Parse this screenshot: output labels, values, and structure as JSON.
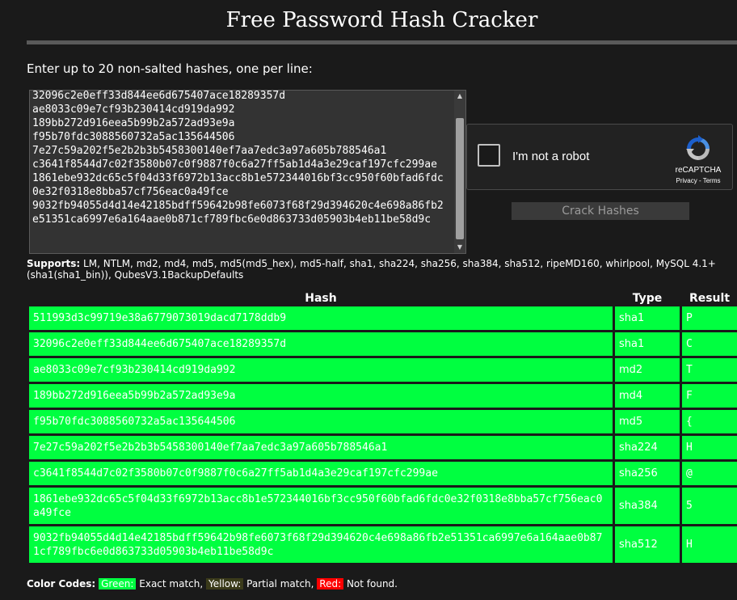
{
  "page": {
    "title": "Free Password Hash Cracker",
    "prompt": "Enter up to 20 non-salted hashes, one per line:",
    "textarea_value": "32096c2e0eff33d844ee6d675407ace18289357d\nae8033c09e7cf93b230414cd919da992\n189bb272d916eea5b99b2a572ad93e9a\nf95b70fdc3088560732a5ac135644506\n7e27c59a202f5e2b2b3b5458300140ef7aa7edc3a97a605b788546a1\nc3641f8544d7c02f3580b07c0f9887f0c6a27ff5ab1d4a3e29caf197cfc299ae\n1861ebe932dc65c5f04d33f6972b13acc8b1e572344016bf3cc950f60bfad6fdc0e32f0318e8bba57cf756eac0a49fce\n9032fb94055d4d14e42185bdff59642b98fe6073f68f29d394620c4e698a86fb2e51351ca6997e6a164aae0b871cf789fbc6e0d863733d05903b4eb11be58d9c",
    "crack_button": "Crack Hashes",
    "supports_label": "Supports:",
    "supports_text": "LM, NTLM, md2, md4, md5, md5(md5_hex), md5-half, sha1, sha224, sha256, sha384, sha512, ripeMD160, whirlpool, MySQL 4.1+ (sha1(sha1_bin)), QubesV3.1BackupDefaults"
  },
  "recaptcha": {
    "label": "I'm not a robot",
    "brand": "reCAPTCHA",
    "privacy": "Privacy",
    "sep": " - ",
    "terms": "Terms"
  },
  "table": {
    "headers": {
      "hash": "Hash",
      "type": "Type",
      "result": "Result"
    },
    "rows": [
      {
        "hash": "511993d3c99719e38a6779073019dacd7178ddb9",
        "type": "sha1",
        "result": "P"
      },
      {
        "hash": "32096c2e0eff33d844ee6d675407ace18289357d",
        "type": "sha1",
        "result": "C"
      },
      {
        "hash": "ae8033c09e7cf93b230414cd919da992",
        "type": "md2",
        "result": "T"
      },
      {
        "hash": "189bb272d916eea5b99b2a572ad93e9a",
        "type": "md4",
        "result": "F"
      },
      {
        "hash": "f95b70fdc3088560732a5ac135644506",
        "type": "md5",
        "result": "{"
      },
      {
        "hash": "7e27c59a202f5e2b2b3b5458300140ef7aa7edc3a97a605b788546a1",
        "type": "sha224",
        "result": "H"
      },
      {
        "hash": "c3641f8544d7c02f3580b07c0f9887f0c6a27ff5ab1d4a3e29caf197cfc299ae",
        "type": "sha256",
        "result": "@"
      },
      {
        "hash": "1861ebe932dc65c5f04d33f6972b13acc8b1e572344016bf3cc950f60bfad6fdc0e32f0318e8bba57cf756eac0a49fce",
        "type": "sha384",
        "result": "5"
      },
      {
        "hash": "9032fb94055d4d14e42185bdff59642b98fe6073f68f29d394620c4e698a86fb2e51351ca6997e6a164aae0b871cf789fbc6e0d863733d05903b4eb11be58d9c",
        "type": "sha512",
        "result": "H"
      }
    ]
  },
  "color_codes": {
    "label": "Color Codes:",
    "green": "Green:",
    "green_desc": " Exact match, ",
    "yellow": "Yellow:",
    "yellow_desc": " Partial match, ",
    "red": "Red:",
    "red_desc": " Not found.",
    "colors": {
      "green": "#00ff40",
      "yellow": "#ffff00",
      "red": "#ff0000"
    }
  },
  "icons": {
    "recaptcha_logo": "recaptcha-icon",
    "scroll_up": "triangle-up-icon",
    "scroll_down": "triangle-down-icon"
  }
}
